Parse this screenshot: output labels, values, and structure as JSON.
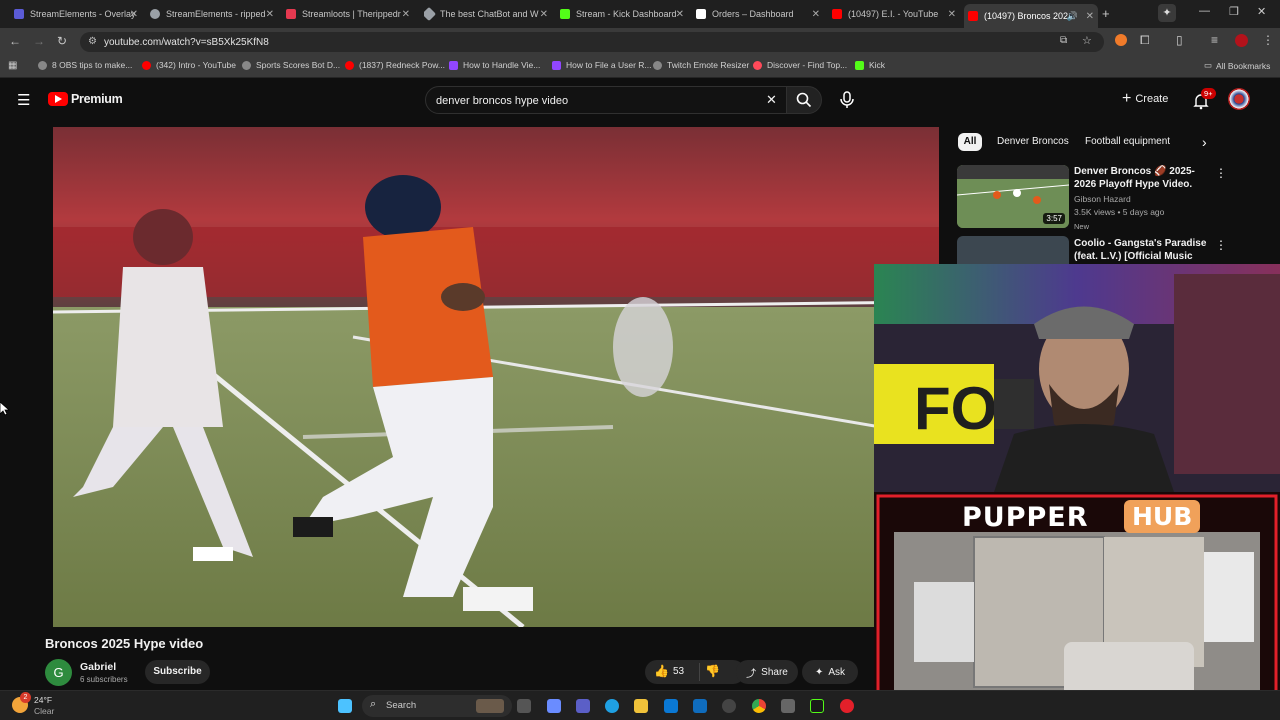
{
  "tabs": [
    {
      "title": "StreamElements - Overlay",
      "color": "#5b5bd6"
    },
    {
      "title": "StreamElements - ripped",
      "color": "#9aa0a6"
    },
    {
      "title": "Streamloots | Therippedr",
      "color": "#e53950"
    },
    {
      "title": "The best ChatBot and W",
      "color": "#9aa0a6"
    },
    {
      "title": "Stream - Kick Dashboard",
      "color": "#53fc18"
    },
    {
      "title": "Orders – Dashboard",
      "color": "#9aa0a6"
    },
    {
      "title": "(10497) E.I. - YouTube",
      "color": "#ff0000"
    },
    {
      "title": "(10497) Broncos 202",
      "color": "#ff0000"
    }
  ],
  "url": "youtube.com/watch?v=sB5Xk25KfN8",
  "bookmarks": [
    {
      "label": "8 OBS tips to make...",
      "color": "#888"
    },
    {
      "label": "(342) Intro - YouTube",
      "color": "#ff0000"
    },
    {
      "label": "Sports Scores Bot D...",
      "color": "#888"
    },
    {
      "label": "(1837) Redneck Pow...",
      "color": "#ff0000"
    },
    {
      "label": "How to Handle Vie...",
      "color": "#9146ff"
    },
    {
      "label": "How to File a User R...",
      "color": "#9146ff"
    },
    {
      "label": "Twitch Emote Resizer",
      "color": "#888"
    },
    {
      "label": "Discover - Find Top...",
      "color": "#ff4a5a"
    },
    {
      "label": "Kick",
      "color": "#53fc18"
    }
  ],
  "all_bookmarks_label": "All Bookmarks",
  "youtube": {
    "logo_text": "Premium",
    "search_value": "denver broncos hype video",
    "create_label": "Create",
    "notifications_badge": "9+"
  },
  "chips": [
    "All",
    "Denver Broncos",
    "Football equipment"
  ],
  "recommendations": [
    {
      "title": "Denver Broncos 🏈 2025-2026 Playoff Hype Video.",
      "channel": "Gibson Hazard",
      "meta": "3.5K views • 5 days ago",
      "badge": "New",
      "duration": "3:57"
    },
    {
      "title": "Coolio - Gangsta's Paradise (feat. L.V.) [Official Music Video]",
      "channel": "",
      "meta": "",
      "badge": "",
      "duration": ""
    }
  ],
  "video": {
    "title": "Broncos 2025 Hype video",
    "channel": "Gabriel",
    "channel_initial": "G",
    "subscribers": "6 subscribers",
    "subscribe_label": "Subscribe",
    "likes": "53",
    "share_label": "Share",
    "ask_label": "Ask"
  },
  "overlay": {
    "hub_word1": "PUPPER",
    "hub_word2": "HUB"
  },
  "taskbar": {
    "temperature": "24°F",
    "condition": "Clear",
    "search_label": "Search",
    "notification_count": "2"
  },
  "colors": {
    "yt_red": "#ff0000",
    "chip_active_bg": "#f1f1f1",
    "hub_orange": "#f0a15a",
    "neon_red": "#e3202a"
  }
}
